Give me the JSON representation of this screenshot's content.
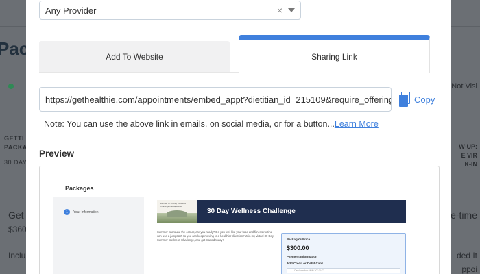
{
  "background": {
    "title": "Pack",
    "text_getti": "GETTI",
    "text_packag": "PACKAG",
    "text_30day": "30 DAY",
    "text_get": "Get",
    "text_360": "$360",
    "text_incl": "Inclu",
    "right_not_visi": "Not Visi",
    "right_up": "W-UP:",
    "right_vir": "E VIR",
    "right_kin": "K-IN",
    "right_time": "e-time",
    "right_ded": "ded It",
    "right_app": "ppoi"
  },
  "modal": {
    "provider_select": {
      "value": "Any Provider",
      "clear_glyph": "×"
    },
    "tabs": {
      "add_to_website": "Add To Website",
      "sharing_link": "Sharing Link",
      "active": "sharing_link"
    },
    "link_input": {
      "value": "https://gethealthie.com/appointments/embed_appt?dietitian_id=215109&require_offering"
    },
    "copy_label": "Copy",
    "note": {
      "text": "Note: You can use the above link in emails, on social media, or for a button...",
      "link": "Learn More"
    },
    "preview": {
      "title": "Preview",
      "packages_heading": "Packages",
      "step_number": "1",
      "step_label": "Your Information",
      "thumb_text": "Summer to 30 Day Wellness Challenge Package Free",
      "banner": "30 Day Wellness Challenge",
      "body": "Summer is around the corner, are you ready? Do you feel like your food and fitness routine can use a jumpstart so you can keep moving to a healthier direction? Join my virtual 30 Day Summer Wellness Challenge, and get started today!",
      "card": {
        "price_label": "Package's Price",
        "price": "$300.00",
        "payment_info": "Payment Information",
        "add_card": "Add Credit or Debit Card",
        "card_number_placeholder": "Card number   MM / YY  CVC"
      }
    }
  },
  "colors": {
    "accent": "#3f80dd",
    "banner": "#1f2e4f",
    "overlay": "#6b6f74"
  }
}
